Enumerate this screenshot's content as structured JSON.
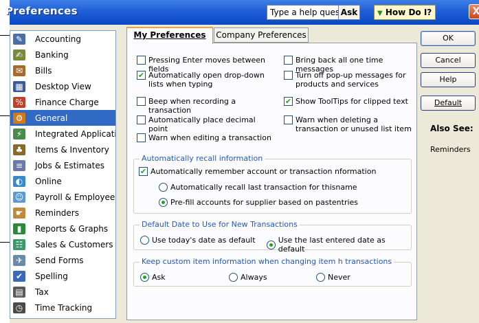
{
  "window": {
    "title": "Preferences"
  },
  "help": {
    "input_text": "Type a help question",
    "ask_label": "Ask",
    "how_do_i_label": "How Do I?",
    "close_label": "X"
  },
  "sidebar": {
    "items": [
      {
        "label": "Accounting",
        "icon": "accounting-icon",
        "color": "#4a6fa8"
      },
      {
        "label": "Banking",
        "icon": "banking-icon",
        "color": "#7a8a3a"
      },
      {
        "label": "Bills",
        "icon": "bills-icon",
        "color": "#a86a2a"
      },
      {
        "label": "Desktop View",
        "icon": "desktop-view-icon",
        "color": "#3a5a9a"
      },
      {
        "label": "Finance Charge",
        "icon": "finance-charge-icon",
        "color": "#c0402a"
      },
      {
        "label": "General",
        "icon": "general-icon",
        "color": "#d07a1a"
      },
      {
        "label": "Integrated Applications",
        "icon": "integrated-applications-icon",
        "color": "#4a8a4a"
      },
      {
        "label": "Items & Inventory",
        "icon": "items-inventory-icon",
        "color": "#8a6a2a"
      },
      {
        "label": "Jobs & Estimates",
        "icon": "jobs-estimates-icon",
        "color": "#6a7aaa"
      },
      {
        "label": "Online",
        "icon": "online-icon",
        "color": "#3a8ac8"
      },
      {
        "label": "Payroll & Employees",
        "icon": "payroll-employees-icon",
        "color": "#5a9ad8"
      },
      {
        "label": "Reminders",
        "icon": "reminders-icon",
        "color": "#c08a3a"
      },
      {
        "label": "Reports & Graphs",
        "icon": "reports-graphs-icon",
        "color": "#2a8a3a"
      },
      {
        "label": "Sales & Customers",
        "icon": "sales-customers-icon",
        "color": "#3a9a6a"
      },
      {
        "label": "Send Forms",
        "icon": "send-forms-icon",
        "color": "#6a8aaa"
      },
      {
        "label": "Spelling",
        "icon": "spelling-icon",
        "color": "#3a6ab8"
      },
      {
        "label": "Tax",
        "icon": "tax-icon",
        "color": "#5a5a5a"
      },
      {
        "label": "Time Tracking",
        "icon": "time-tracking-icon",
        "color": "#4a4a4a"
      }
    ],
    "selected_index": 5
  },
  "tabs": [
    {
      "label": "My Preferences"
    },
    {
      "label": "Company Preferences"
    }
  ],
  "prefs": {
    "left": [
      {
        "label": "Pressing Enter moves between fields",
        "checked": false
      },
      {
        "label": "Automatically open drop-down lists when typing",
        "checked": true
      },
      {
        "label": "Beep when recording a transaction",
        "checked": false
      },
      {
        "label": "Automatically place decimal point",
        "checked": false
      },
      {
        "label": "Warn when editing a transaction",
        "checked": false
      }
    ],
    "right": [
      {
        "label": "Bring back all one time messages",
        "checked": false
      },
      {
        "label": "Turn off pop-up messages for products and services",
        "checked": false
      },
      {
        "label": "Show ToolTips for clipped text",
        "checked": true
      },
      {
        "label": "Warn when deleting a transaction or unused list item",
        "checked": false
      }
    ]
  },
  "recall": {
    "title": "Automatically recall information",
    "remember_label": "Automatically remember account or transaction nformation",
    "remember_checked": true,
    "option_last": "Automatically recall last transaction for thisname",
    "option_prefill": "Pre-fill accounts for supplier based on pastentries",
    "selected": "prefill"
  },
  "default_date": {
    "title": "Default Date to Use for New Transactions",
    "option_today": "Use today's date as default",
    "option_last": "Use the last entered date as default",
    "selected": "last"
  },
  "custom_item": {
    "title": "Keep custom item information when changing item h transactions",
    "option_ask": "Ask",
    "option_always": "Always",
    "option_never": "Never",
    "selected": "ask"
  },
  "buttons": {
    "ok": "OK",
    "cancel": "Cancel",
    "help": "Help",
    "default": "Default"
  },
  "also_see": {
    "title": "Also See:",
    "link": "Reminders"
  }
}
